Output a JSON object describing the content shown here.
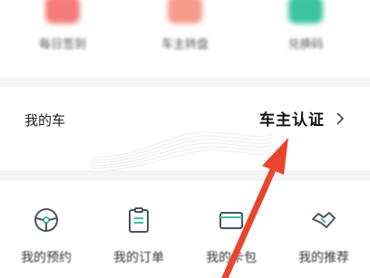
{
  "top_actions": [
    {
      "label": "每日签到",
      "icon": "calendar-icon",
      "color": "#f47a7a"
    },
    {
      "label": "车主转盘",
      "icon": "wheel-icon",
      "color": "#f79a8a"
    },
    {
      "label": "兑换码",
      "icon": "code-icon",
      "color": "#3cc3a0"
    }
  ],
  "my_car": {
    "title": "我的车",
    "link_label": "车主认证"
  },
  "services": [
    {
      "label": "我的预约",
      "icon": "steering-wheel-icon"
    },
    {
      "label": "我的订单",
      "icon": "clipboard-icon"
    },
    {
      "label": "我的卡包",
      "icon": "card-icon"
    },
    {
      "label": "我的推荐",
      "icon": "handshake-icon"
    }
  ],
  "colors": {
    "annotation_arrow": "#e8452f",
    "divider": "#f3f4f6"
  }
}
